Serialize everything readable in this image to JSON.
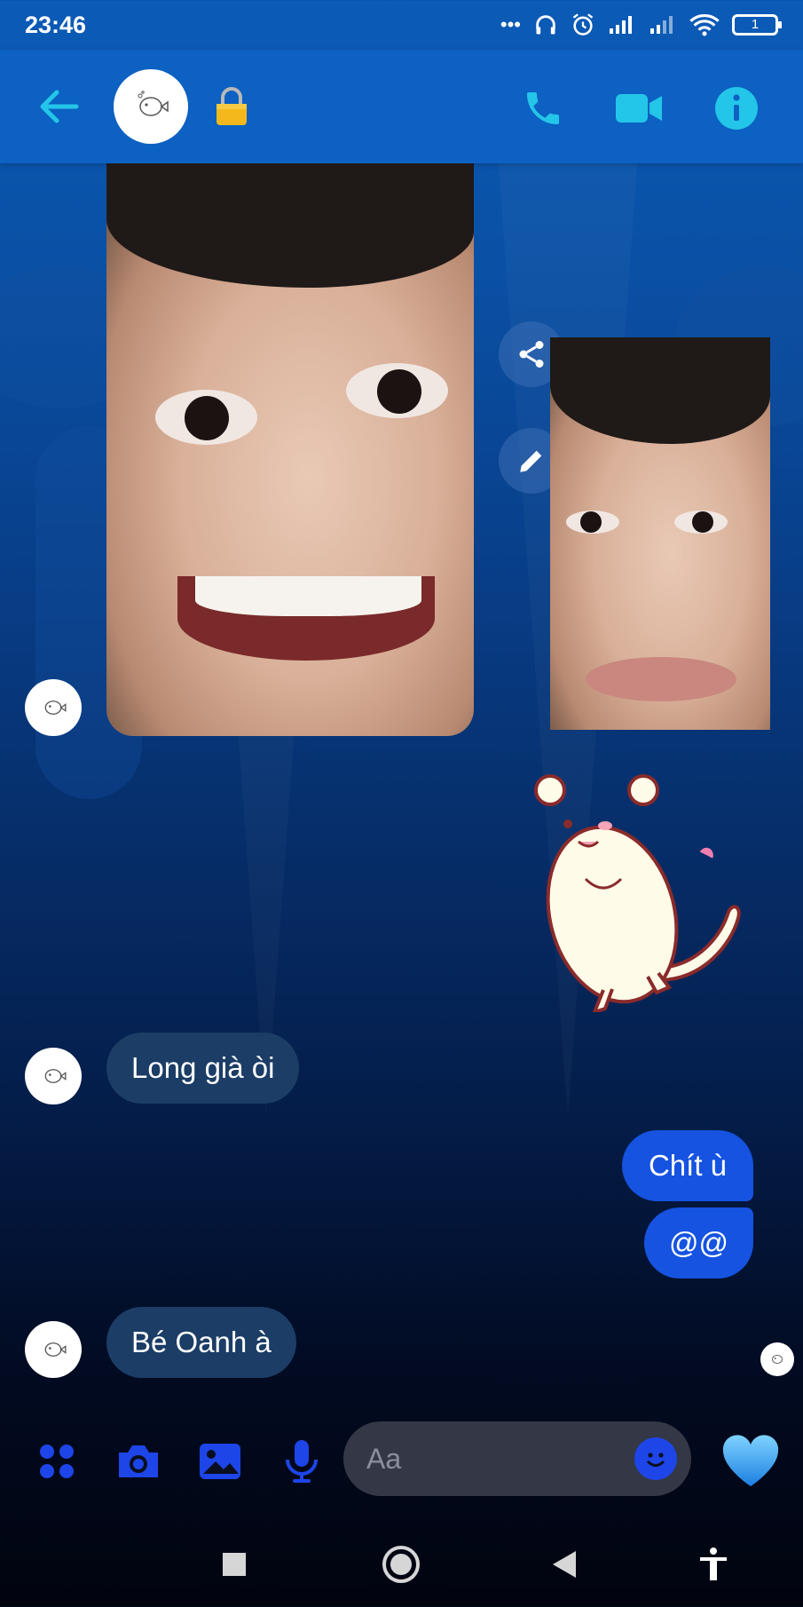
{
  "status_bar": {
    "time": "23:46",
    "battery_level": "1"
  },
  "header": {
    "back_icon": "arrow-left-icon",
    "lock_icon": "lock-icon",
    "call_icon": "phone-icon",
    "video_icon": "video-camera-icon",
    "info_icon": "info-icon",
    "accent_color": "#23c6e8"
  },
  "messages": {
    "incoming_1": "Long già òi",
    "outgoing_1": "Chít ù",
    "outgoing_2": "@@",
    "incoming_2": "Bé Oanh à"
  },
  "media_actions": {
    "share_icon": "share-icon",
    "edit_icon": "pencil-icon"
  },
  "composer": {
    "placeholder": "Aa",
    "menu_icon": "grid-dots-icon",
    "camera_icon": "camera-icon",
    "gallery_icon": "image-icon",
    "mic_icon": "microphone-icon",
    "emoji_icon": "smile-icon",
    "heart_icon": "heart-icon",
    "icon_color": "#1d45e8"
  },
  "nav": {
    "recents_icon": "square-icon",
    "home_icon": "circle-icon",
    "back_icon": "triangle-back-icon",
    "accessibility_icon": "accessibility-icon"
  },
  "colors": {
    "header_bg": "#0c61c2",
    "incoming_bubble": "#1b3d66",
    "outgoing_bubble": "#1553e0"
  }
}
